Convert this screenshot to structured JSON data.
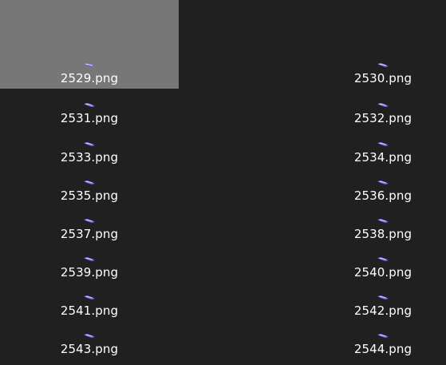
{
  "colors": {
    "background": "#202020",
    "selected_tile": "#777777",
    "label_text": "#ffffff",
    "thumb_accent": "#6b6be8"
  },
  "files": [
    {
      "name": "2529.png",
      "thumb": "thumbnail-icon",
      "selected": true
    },
    {
      "name": "2530.png",
      "thumb": "thumbnail-icon",
      "selected": false
    },
    {
      "name": "2531.png",
      "thumb": "thumbnail-icon",
      "selected": false
    },
    {
      "name": "2532.png",
      "thumb": "thumbnail-icon",
      "selected": false
    },
    {
      "name": "2533.png",
      "thumb": "thumbnail-icon",
      "selected": false
    },
    {
      "name": "2534.png",
      "thumb": "thumbnail-icon",
      "selected": false
    },
    {
      "name": "2535.png",
      "thumb": "thumbnail-icon",
      "selected": false
    },
    {
      "name": "2536.png",
      "thumb": "thumbnail-icon",
      "selected": false
    },
    {
      "name": "2537.png",
      "thumb": "thumbnail-icon",
      "selected": false
    },
    {
      "name": "2538.png",
      "thumb": "thumbnail-icon",
      "selected": false
    },
    {
      "name": "2539.png",
      "thumb": "thumbnail-icon",
      "selected": false
    },
    {
      "name": "2540.png",
      "thumb": "thumbnail-icon",
      "selected": false
    },
    {
      "name": "2541.png",
      "thumb": "thumbnail-icon",
      "selected": false
    },
    {
      "name": "2542.png",
      "thumb": "thumbnail-icon",
      "selected": false
    },
    {
      "name": "2543.png",
      "thumb": "thumbnail-icon",
      "selected": false
    },
    {
      "name": "2544.png",
      "thumb": "thumbnail-icon",
      "selected": false
    }
  ]
}
